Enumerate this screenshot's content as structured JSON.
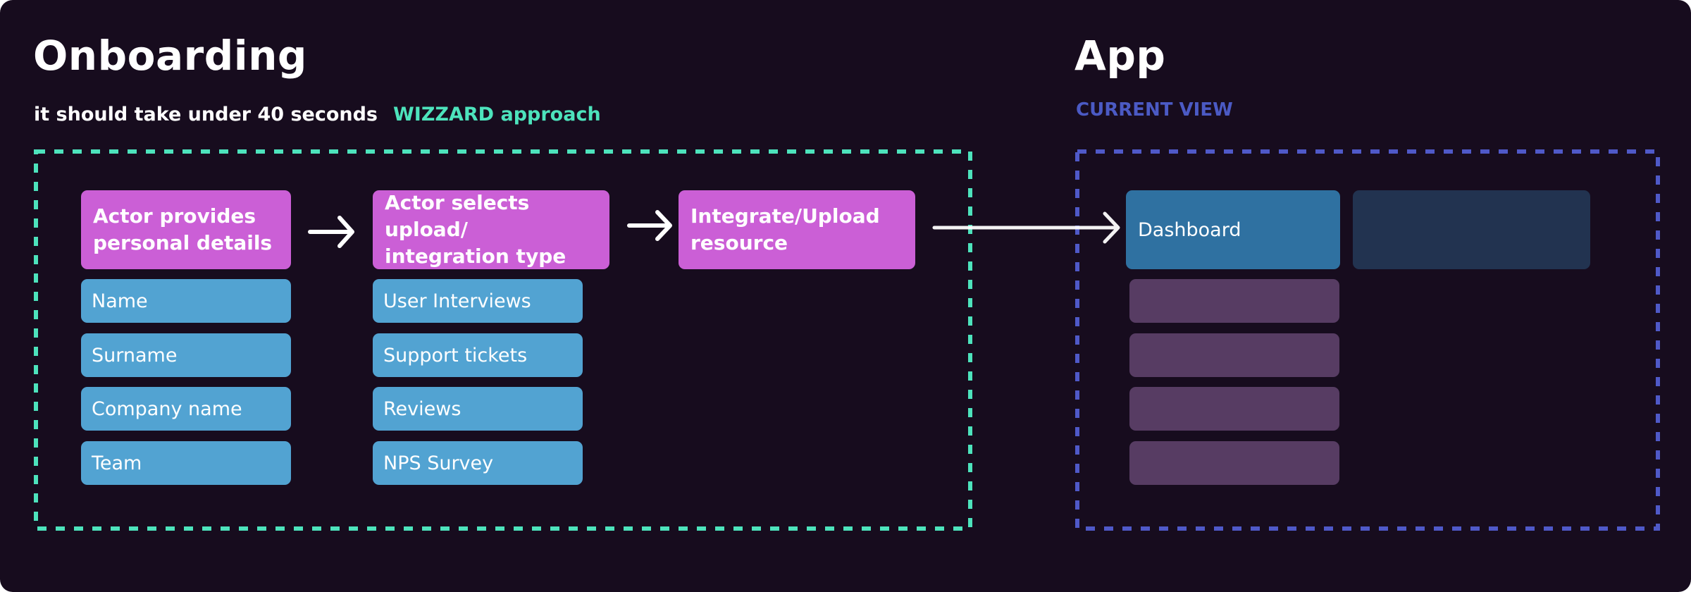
{
  "onboarding": {
    "title": "Onboarding",
    "subtitle": "it should take under 40 seconds",
    "approach": "WIZZARD approach",
    "steps": [
      {
        "label": "Actor provides\npersonal details",
        "fields": [
          "Name",
          "Surname",
          "Company name",
          "Team"
        ]
      },
      {
        "label": "Actor selects upload/\nintegration type",
        "fields": [
          "User Interviews",
          "Support tickets",
          "Reviews",
          "NPS Survey"
        ]
      },
      {
        "label": "Integrate/Upload\nresource",
        "fields": []
      }
    ]
  },
  "app": {
    "title": "App",
    "section_label": "CURRENT VIEW",
    "dashboard_label": "Dashboard",
    "placeholder_count": 4
  },
  "colors": {
    "background": "#170c1e",
    "onboarding_border": "#4de3bc",
    "app_border": "#4f59c8",
    "step_card": "#cb5fd6",
    "field_card": "#52a3d2",
    "dashboard_card": "#2f71a1",
    "content_card": "#223350",
    "nav_placeholder": "#573c63",
    "current_view_label": "#4b5ac4"
  }
}
